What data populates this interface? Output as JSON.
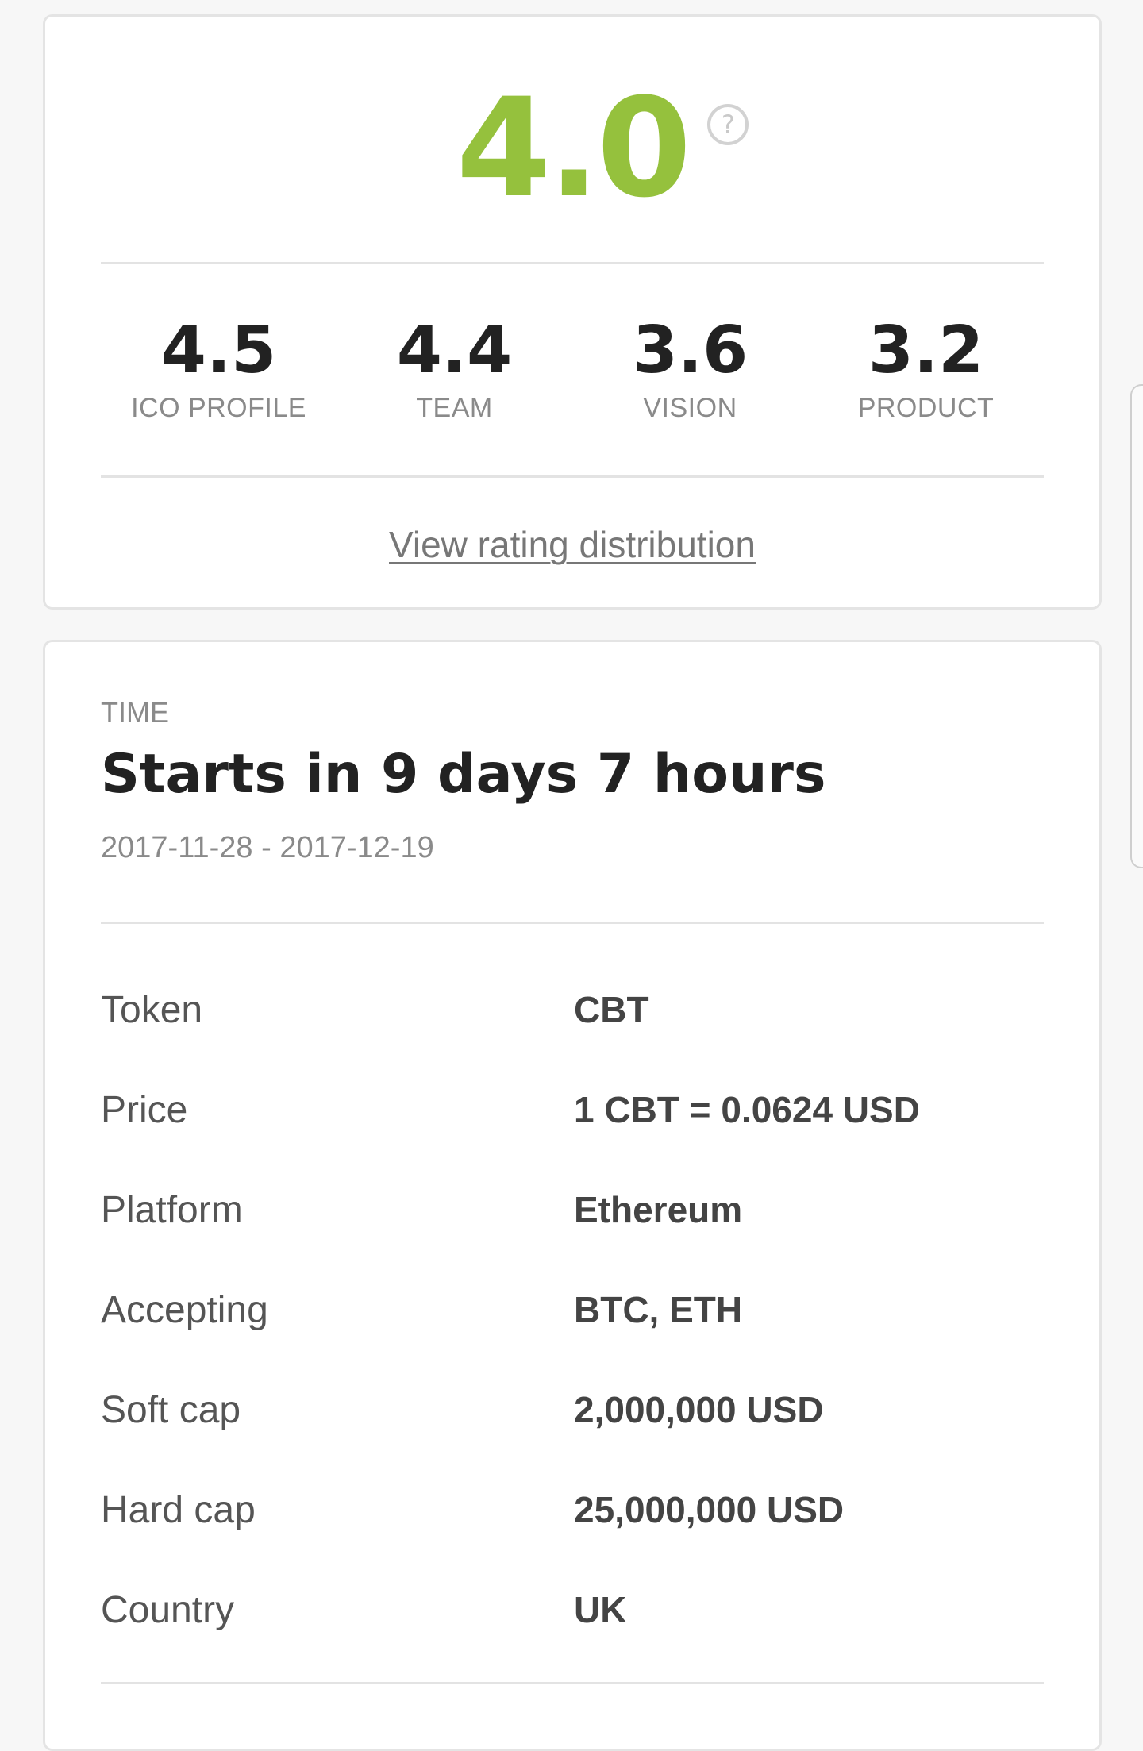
{
  "rating": {
    "overall": "4.0",
    "help_icon": "question-circle-icon",
    "sub_scores": [
      {
        "value": "4.5",
        "label": "ICO PROFILE"
      },
      {
        "value": "4.4",
        "label": "TEAM"
      },
      {
        "value": "3.6",
        "label": "VISION"
      },
      {
        "value": "3.2",
        "label": "PRODUCT"
      }
    ],
    "link_label": "View rating distribution"
  },
  "time": {
    "label": "TIME",
    "title": "Starts in 9 days 7 hours",
    "dates": "2017-11-28 - 2017-12-19"
  },
  "details": [
    {
      "key": "Token",
      "value": "CBT"
    },
    {
      "key": "Price",
      "value": "1 CBT = 0.0624 USD"
    },
    {
      "key": "Platform",
      "value": "Ethereum"
    },
    {
      "key": "Accepting",
      "value": "BTC, ETH"
    },
    {
      "key": "Soft cap",
      "value": "2,000,000 USD"
    },
    {
      "key": "Hard cap",
      "value": "25,000,000 USD"
    },
    {
      "key": "Country",
      "value": "UK"
    }
  ],
  "colors": {
    "accent_green": "#95c13d",
    "muted_text": "#8a8a8a",
    "divider": "#e3e3e3"
  }
}
